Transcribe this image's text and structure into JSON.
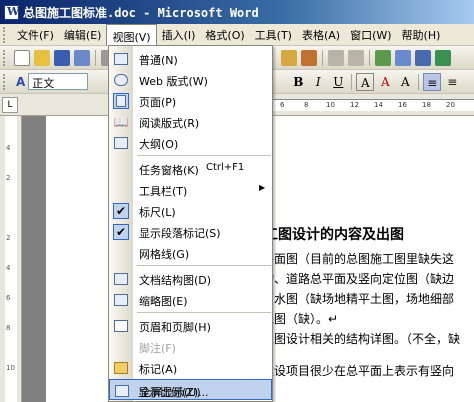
{
  "window": {
    "title": "总图施工图标准.doc - Microsoft Word"
  },
  "menubar": [
    "文件(F)",
    "编辑(E)",
    "视图(V)",
    "插入(I)",
    "格式(O)",
    "工具(T)",
    "表格(A)",
    "窗口(W)",
    "帮助(H)"
  ],
  "active_menu_index": 2,
  "formatting_toolbar": {
    "style_icon": "A",
    "style_value": "正文",
    "bold": "B",
    "italic": "I",
    "underline": "U",
    "highlight": "A",
    "font_color": "A",
    "char_scale": "A"
  },
  "ruler": {
    "ticks": [
      "6",
      "8",
      "10",
      "12",
      "14",
      "16",
      "18",
      "20"
    ]
  },
  "vruler": {
    "ticks": [
      "4",
      "2",
      "2",
      "4",
      "6",
      "8",
      "10"
    ]
  },
  "view_menu": {
    "items": [
      {
        "label": "普通(N)",
        "icon": "normal-view-icon"
      },
      {
        "label": "Web 版式(W)",
        "icon": "web-layout-icon"
      },
      {
        "label": "页面(P)",
        "icon": "print-layout-icon",
        "checked": true
      },
      {
        "label": "阅读版式(R)",
        "icon": "reading-layout-icon"
      },
      {
        "label": "大纲(O)",
        "icon": "outline-view-icon"
      },
      {
        "label": "任务窗格(K)",
        "shortcut": "Ctrl+F1"
      },
      {
        "label": "工具栏(T)",
        "submenu": true
      },
      {
        "label": "标尺(L)",
        "checked": true
      },
      {
        "label": "显示段落标记(S)",
        "checked": true
      },
      {
        "label": "网格线(G)"
      },
      {
        "label": "文档结构图(D)",
        "icon": "document-map-icon"
      },
      {
        "label": "缩略图(E)",
        "icon": "thumbnails-icon"
      },
      {
        "label": "页眉和页脚(H)",
        "icon": "header-footer-icon"
      },
      {
        "label": "脚注(F)",
        "disabled": true
      },
      {
        "label": "标记(A)",
        "icon": "markup-icon"
      },
      {
        "label": "全屏显示(U)",
        "icon": "fullscreen-icon",
        "highlight": true
      },
      {
        "label": "显示比例(Z)..."
      }
    ]
  },
  "document": {
    "heading": "图施工图设计的内容及出图",
    "lines": [
      "总平面图（目前的总图施工图里缺失这",
      "筑物、道路总平面及竖向定位图（缺边",
      "排雨水图（缺场地精平土图，场地细部",
      "管线图（缺）。↵",
      "与总图设计相关的结构详图。（不全，缺",
      "的建设项目很少在总平面上表示有竖向"
    ]
  },
  "colors": {
    "titlebar": "#0a246a",
    "menu_highlight": "#c1d2ee",
    "menu_border": "#316ac5"
  }
}
